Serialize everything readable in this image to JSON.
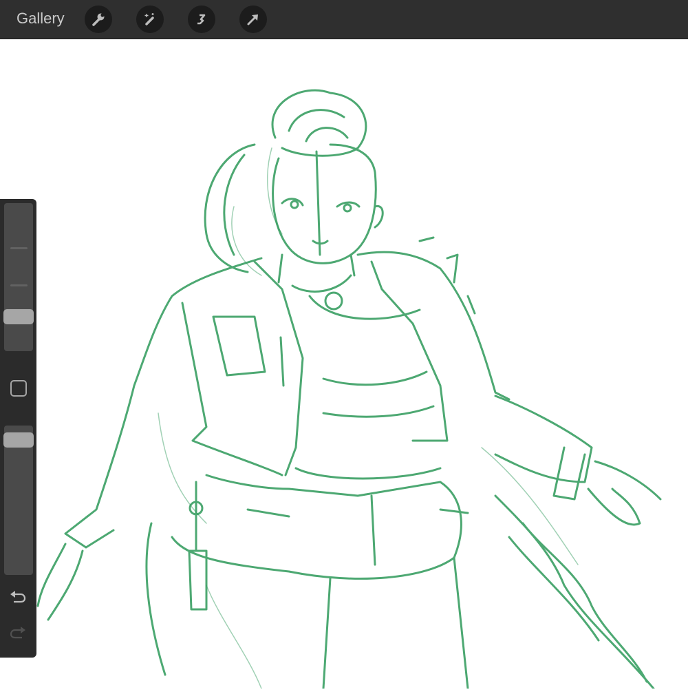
{
  "topbar": {
    "gallery_label": "Gallery",
    "tools": [
      {
        "name": "actions",
        "icon": "wrench-icon"
      },
      {
        "name": "adjustments",
        "icon": "magic-wand-icon"
      },
      {
        "name": "selection",
        "icon": "selection-s-icon"
      },
      {
        "name": "transform",
        "icon": "arrow-cursor-icon"
      }
    ]
  },
  "sidebar": {
    "brush_size": 0.2,
    "brush_opacity": 0.95,
    "undo_icon": "undo-icon",
    "redo_icon": "redo-icon"
  },
  "canvas": {
    "stroke_color": "#2e9a5a",
    "background": "#ffffff"
  }
}
